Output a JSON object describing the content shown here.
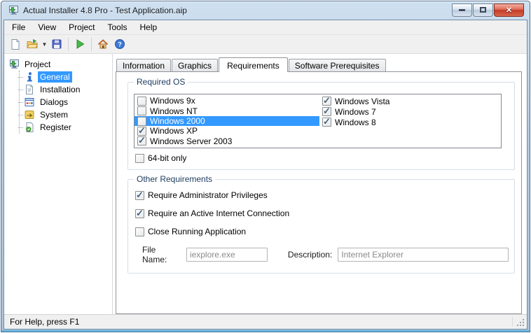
{
  "window": {
    "title": "Actual Installer 4.8 Pro - Test Application.aip",
    "app_icon": "installer-app-icon",
    "controls": {
      "minimize": "minimize",
      "maximize": "maximize",
      "close": "close"
    }
  },
  "menu": {
    "items": [
      "File",
      "View",
      "Project",
      "Tools",
      "Help"
    ]
  },
  "toolbar": {
    "icons": [
      "new-project-icon",
      "open-project-icon",
      "open-dropdown-arrow",
      "save-icon",
      "build-run-icon",
      "home-icon",
      "help-icon"
    ]
  },
  "sidebar": {
    "root_label": "Project",
    "root_icon": "project-monitor-icon",
    "items": [
      {
        "label": "General",
        "selected": true,
        "icon": "info-icon"
      },
      {
        "label": "Installation",
        "selected": false,
        "icon": "installation-page-icon"
      },
      {
        "label": "Dialogs",
        "selected": false,
        "icon": "dialogs-window-icon"
      },
      {
        "label": "System",
        "selected": false,
        "icon": "system-icon"
      },
      {
        "label": "Register",
        "selected": false,
        "icon": "register-page-icon"
      }
    ]
  },
  "tabs": {
    "items": [
      {
        "label": "Information",
        "active": false
      },
      {
        "label": "Graphics",
        "active": false
      },
      {
        "label": "Requirements",
        "active": true
      },
      {
        "label": "Software Prerequisites",
        "active": false
      }
    ]
  },
  "required_os": {
    "title": "Required OS",
    "left": [
      {
        "label": "Windows 9x",
        "checked": false,
        "selected": false
      },
      {
        "label": "Windows NT",
        "checked": false,
        "selected": false
      },
      {
        "label": "Windows 2000",
        "checked": false,
        "selected": true
      },
      {
        "label": "Windows XP",
        "checked": true,
        "selected": false
      },
      {
        "label": "Windows Server 2003",
        "checked": true,
        "selected": false
      }
    ],
    "right": [
      {
        "label": "Windows Vista",
        "checked": true
      },
      {
        "label": "Windows 7",
        "checked": true
      },
      {
        "label": "Windows 8",
        "checked": true
      }
    ],
    "bit64": {
      "label": "64-bit only",
      "checked": false
    }
  },
  "other_requirements": {
    "title": "Other Requirements",
    "items": [
      {
        "label": "Require Administrator Privileges",
        "checked": true
      },
      {
        "label": "Require an Active Internet Connection",
        "checked": true
      },
      {
        "label": "Close Running Application",
        "checked": false
      }
    ],
    "file_name": {
      "label": "File Name:",
      "value": "iexplore.exe"
    },
    "description": {
      "label": "Description:",
      "value": "Internet Explorer"
    }
  },
  "status_bar": {
    "text": "For Help, press F1"
  },
  "colors": {
    "selection": "#3399ff",
    "close_button": "#c23b28",
    "check": "#44627e"
  }
}
